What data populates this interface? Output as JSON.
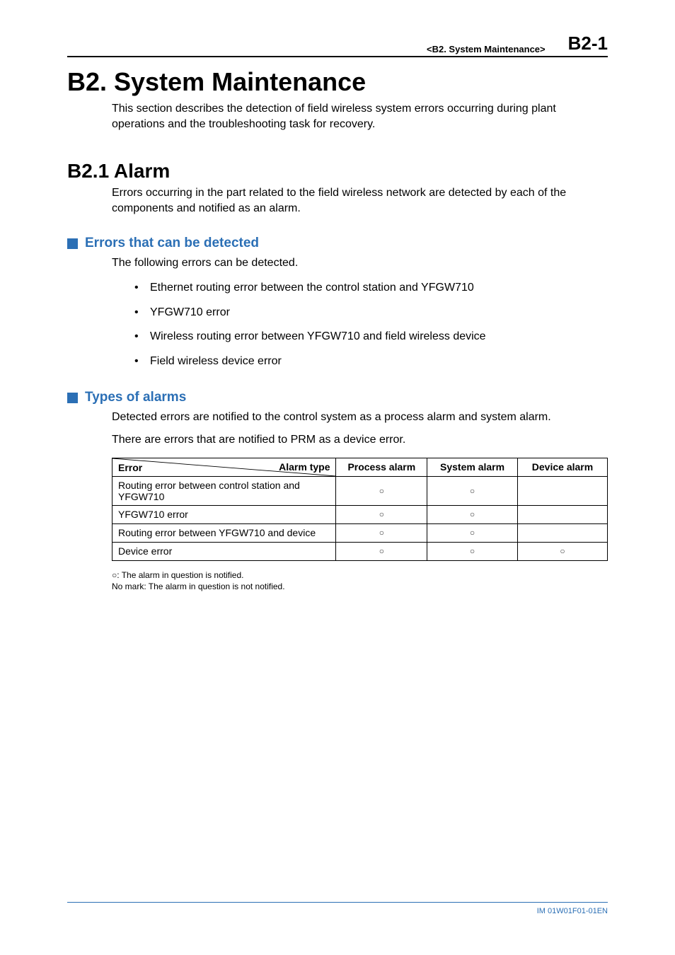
{
  "header": {
    "breadcrumb": "<B2.  System Maintenance>",
    "page_number": "B2-1"
  },
  "title": "B2.    System Maintenance",
  "intro": "This section describes the detection of field wireless system errors occurring during plant operations and the troubleshooting task for recovery.",
  "section": {
    "heading": "B2.1    Alarm",
    "intro": "Errors occurring in the part related to the field wireless network are detected by each of the components and notified as an alarm."
  },
  "errors_detected": {
    "heading": "Errors that can be detected",
    "intro": "The following errors can be detected.",
    "items": [
      "Ethernet routing error between the control station and YFGW710",
      "YFGW710 error",
      "Wireless routing error between YFGW710 and field wireless device",
      "Field wireless device error"
    ]
  },
  "alarm_types": {
    "heading": "Types of alarms",
    "para1": "Detected errors are notified to the control system as a process alarm and system alarm.",
    "para2": "There are errors that are notified to PRM as a device error.",
    "table": {
      "diag_left": "Error",
      "diag_right": "Alarm type",
      "cols": [
        "Process alarm",
        "System alarm",
        "Device alarm"
      ],
      "rows": [
        {
          "label": "Routing error between control station and YFGW710",
          "marks": [
            "○",
            "○",
            ""
          ]
        },
        {
          "label": "YFGW710 error",
          "marks": [
            "○",
            "○",
            ""
          ]
        },
        {
          "label": "Routing error between YFGW710 and device",
          "marks": [
            "○",
            "○",
            ""
          ]
        },
        {
          "label": "Device error",
          "marks": [
            "○",
            "○",
            "○"
          ]
        }
      ]
    },
    "notes": [
      "○: The alarm in question is notified.",
      "No mark: The alarm in question is not notified."
    ]
  },
  "footer": {
    "doc_id": "IM 01W01F01-01EN"
  }
}
